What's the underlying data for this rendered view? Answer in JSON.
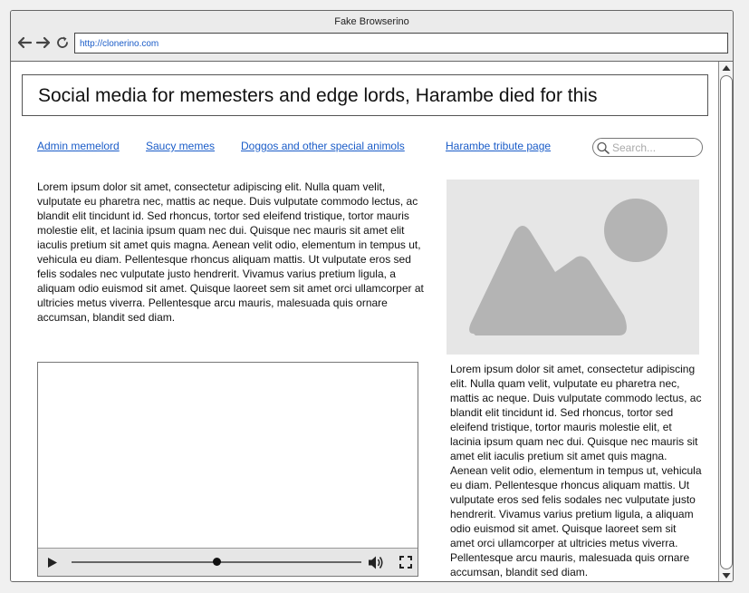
{
  "browser": {
    "title": "Fake Browserino",
    "url": "http://clonerino.com"
  },
  "page": {
    "header_title": "Social media for memesters and edge lords, Harambe died for this",
    "nav": [
      {
        "label": "Admin memelord"
      },
      {
        "label": "Saucy memes"
      },
      {
        "label": "Doggos and other special animols"
      },
      {
        "label": "Harambe tribute page"
      }
    ],
    "search": {
      "placeholder": "Search..."
    },
    "paragraph_left": "Lorem ipsum dolor sit amet, consectetur adipiscing elit. Nulla quam velit, vulputate eu pharetra nec, mattis ac neque. Duis vulputate commodo lectus, ac blandit elit tincidunt id. Sed rhoncus, tortor sed eleifend tristique, tortor mauris molestie elit, et lacinia ipsum quam nec dui. Quisque nec mauris sit amet elit iaculis pretium sit amet quis magna. Aenean velit odio, elementum in tempus ut, vehicula eu diam. Pellentesque rhoncus aliquam mattis. Ut vulputate eros sed felis sodales nec vulputate justo hendrerit. Vivamus varius pretium ligula, a aliquam odio euismod sit amet. Quisque laoreet sem sit amet orci ullamcorper at ultricies metus viverra. Pellentesque arcu mauris, malesuada quis ornare accumsan, blandit sed diam.",
    "paragraph_right": "Lorem ipsum dolor sit amet, consectetur adipiscing elit. Nulla quam velit, vulputate eu pharetra nec, mattis ac neque. Duis vulputate commodo lectus, ac blandit elit tincidunt id. Sed rhoncus, tortor sed eleifend tristique, tortor mauris molestie elit, et lacinia ipsum quam nec dui. Quisque nec mauris sit amet elit iaculis pretium sit amet quis magna. Aenean velit odio, elementum in tempus ut, vehicula eu diam. Pellentesque rhoncus aliquam mattis. Ut vulputate eros sed felis sodales nec vulputate justo hendrerit. Vivamus varius pretium ligula, a aliquam odio euismod sit amet. Quisque laoreet sem sit amet orci ullamcorper at ultricies metus viverra. Pellentesque arcu mauris, malesuada quis ornare accumsan, blandit sed diam.",
    "video": {
      "progress": 0.5
    }
  },
  "icons": {
    "back": "arrow-left-icon",
    "forward": "arrow-right-icon",
    "reload": "reload-icon",
    "search": "magnifier-icon",
    "image": "image-placeholder-icon",
    "play": "play-icon",
    "volume": "volume-icon",
    "fullscreen": "fullscreen-icon"
  },
  "colors": {
    "link": "#1a5cc8",
    "placeholder_gray": "#b4b4b4"
  }
}
